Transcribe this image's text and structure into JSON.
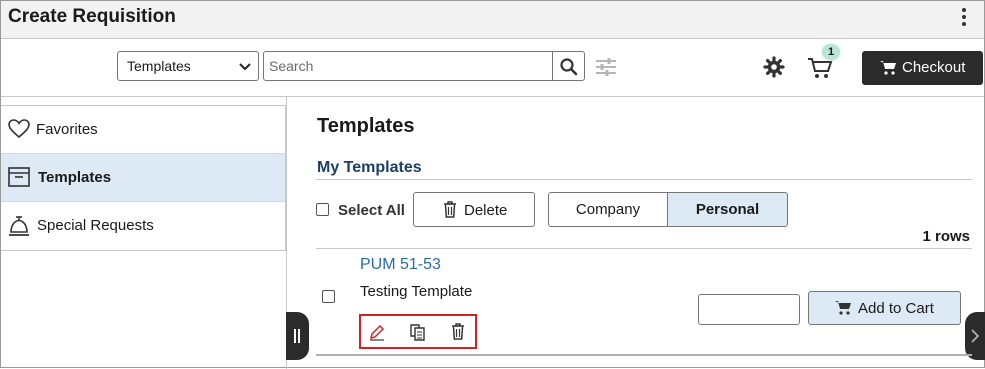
{
  "header": {
    "title": "Create Requisition",
    "more_icon": "vertical-ellipsis-icon"
  },
  "toolbar": {
    "search_type": {
      "selected": "Templates"
    },
    "search": {
      "placeholder": "Search"
    },
    "cart_count": "1",
    "checkout_label": "Checkout"
  },
  "sidebar": {
    "items": [
      {
        "label": "Favorites",
        "icon": "heart-icon",
        "active": false
      },
      {
        "label": "Templates",
        "icon": "template-box-icon",
        "active": true
      },
      {
        "label": "Special Requests",
        "icon": "service-bell-icon",
        "active": false
      }
    ]
  },
  "main": {
    "title": "Templates",
    "section_title": "My Templates",
    "select_all_label": "Select All",
    "delete_label": "Delete",
    "segments": {
      "company": "Company",
      "personal": "Personal",
      "selected": "Personal"
    },
    "row_count": "1 rows",
    "rows": [
      {
        "name": "PUM 51-53",
        "description": "Testing Template",
        "quantity": "",
        "add_to_cart_label": "Add to Cart",
        "actions": [
          "edit-icon",
          "copy-icon",
          "trash-icon"
        ]
      }
    ]
  },
  "colors": {
    "accent_bg": "#dde9f5",
    "link": "#2a6ba8",
    "section_title": "#1c3f66",
    "highlight_box": "#d32121",
    "dark_button": "#2b2b2b"
  }
}
